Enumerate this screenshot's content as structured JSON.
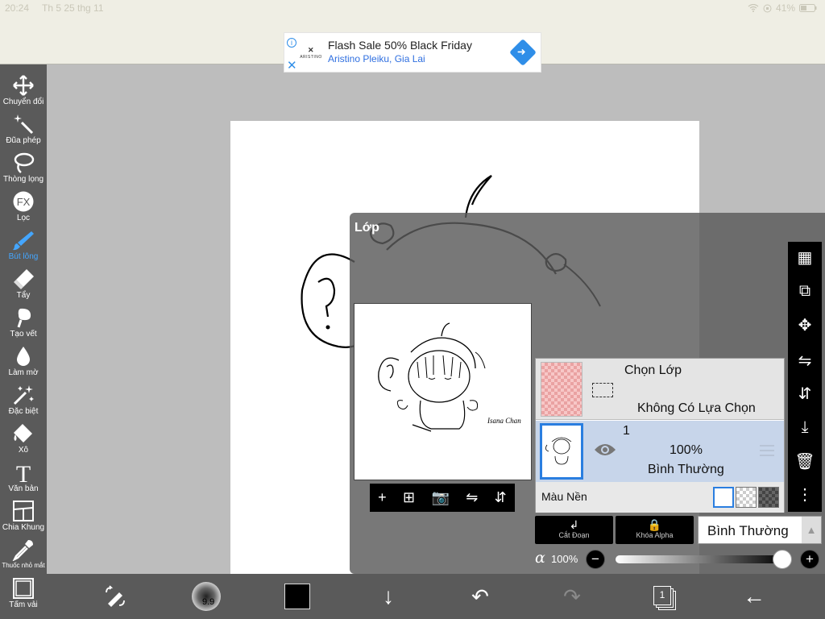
{
  "status": {
    "time": "20:24",
    "date": "Th 5 25 thg 11",
    "battery": "41%"
  },
  "ad": {
    "brand": "ARISTINO",
    "title": "Flash Sale 50% Black Friday",
    "subtitle": "Aristino Pleiku, Gia Lai",
    "info_icon": "info-icon",
    "close_icon": "close-icon",
    "go_icon": "directions-icon"
  },
  "toolbar": {
    "active": "Bút lông",
    "tools": [
      {
        "label": "Chuyển đổi",
        "icon": "move-icon"
      },
      {
        "label": "Đũa phép",
        "icon": "magic-wand-icon"
      },
      {
        "label": "Thòng lọng",
        "icon": "lasso-icon"
      },
      {
        "label": "Lọc",
        "icon": "fx-icon",
        "icon_text": "FX"
      },
      {
        "label": "Bút lông",
        "icon": "brush-icon"
      },
      {
        "label": "Tẩy",
        "icon": "eraser-icon"
      },
      {
        "label": "Tạo vết",
        "icon": "smudge-icon"
      },
      {
        "label": "Làm mờ",
        "icon": "blur-drop-icon"
      },
      {
        "label": "Đặc biệt",
        "icon": "special-wand-icon"
      },
      {
        "label": "Xô",
        "icon": "bucket-icon"
      },
      {
        "label": "Văn bản",
        "icon": "text-icon",
        "icon_text": "T"
      },
      {
        "label": "Chia Khung",
        "icon": "frame-divider-icon"
      },
      {
        "label": "Thuốc nhỏ mắt",
        "icon": "eyedropper-icon"
      },
      {
        "label": "Tấm vải",
        "icon": "canvas-icon"
      }
    ]
  },
  "layer_panel": {
    "title": "Lớp",
    "thumb_toolbar": [
      "add-layer-icon",
      "add-copy-icon",
      "camera-icon",
      "flip-horizontal-icon",
      "flip-vertical-icon"
    ],
    "thumb_toolbar_glyphs": [
      "+",
      "⊞",
      "📷",
      "⇋",
      "⇵"
    ],
    "artwork_signature": "Isana Chan"
  },
  "right_tools": {
    "icons": [
      "transparency-icon",
      "select-transform-icon",
      "move-icon",
      "flip-horizontal-icon",
      "flip-vertical-icon",
      "merge-down-icon",
      "trash-icon",
      "more-icon"
    ],
    "glyphs": [
      "▦",
      "⧉",
      "✥",
      "⇋",
      "⇵",
      "⤓",
      "🗑",
      "⋮"
    ]
  },
  "layers": {
    "selection_row": {
      "title": "Chọn Lớp",
      "status": "Không Có Lựa Chọn"
    },
    "layer_1": {
      "number": "1",
      "opacity": "100%",
      "mode": "Bình Thường",
      "visible": true
    },
    "background": {
      "label": "Màu Nền",
      "options": [
        "white",
        "checker",
        "dark-checker"
      ],
      "selected": "white"
    }
  },
  "controls": {
    "clip_label": "Cắt Đoạn",
    "clip_icon": "↲",
    "alpha_label": "Khóa Alpha",
    "alpha_icon": "🔒",
    "blend_mode": "Bình Thường",
    "blend_arrow": "▲",
    "opacity_symbol": "α",
    "opacity_value": "100%",
    "opacity_level": 1.0,
    "minus": "−",
    "plus": "+"
  },
  "bottom_bar": {
    "brush_size": "9.9",
    "color": "#000000",
    "page_count": "1",
    "icons": [
      "modify-tool-icon",
      "brush-size-icon",
      "color-swatch-icon",
      "download-arrow-icon",
      "undo-icon",
      "redo-icon",
      "layers-count-icon",
      "back-arrow-icon"
    ],
    "glyphs": {
      "download": "↓",
      "undo": "↶",
      "redo": "↷",
      "back": "←"
    }
  },
  "colors": {
    "accent": "#2a7ee0",
    "active_tool": "#44a6ff",
    "toolbar": "#5a5a5a"
  }
}
